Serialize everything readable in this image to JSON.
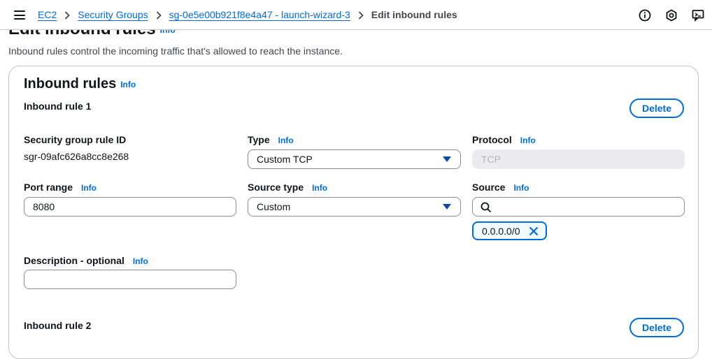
{
  "breadcrumb": {
    "items": [
      "EC2",
      "Security Groups",
      "sg-0e5e00b921f8e4a47 - launch-wizard-3"
    ],
    "current": "Edit inbound rules"
  },
  "page": {
    "title": "Edit inbound rules",
    "info": "Info",
    "description": "Inbound rules control the incoming traffic that's allowed to reach the instance."
  },
  "container": {
    "title": "Inbound rules",
    "info": "Info"
  },
  "rules": [
    {
      "heading": "Inbound rule 1",
      "delete_label": "Delete",
      "rule_id_label": "Security group rule ID",
      "rule_id": "sgr-09afc626a8cc8e268",
      "type_label": "Type",
      "type_value": "Custom TCP",
      "protocol_label": "Protocol",
      "protocol_value": "TCP",
      "port_label": "Port range",
      "port_value": "8080",
      "source_type_label": "Source type",
      "source_type_value": "Custom",
      "source_label": "Source",
      "source_search_value": "",
      "source_token": "0.0.0.0/0",
      "description_label": "Description - optional",
      "description_value": "",
      "info": "Info"
    },
    {
      "heading": "Inbound rule 2",
      "delete_label": "Delete"
    }
  ]
}
